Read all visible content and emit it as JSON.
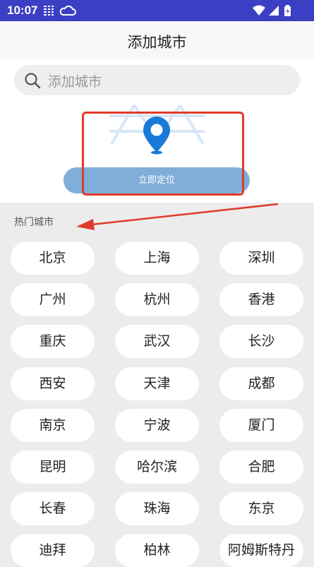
{
  "status_bar": {
    "time": "10:07"
  },
  "header": {
    "title": "添加城市"
  },
  "search": {
    "placeholder": "添加城市"
  },
  "locate": {
    "button_label": "立即定位"
  },
  "hot_cities": {
    "label": "热门城市",
    "cities": [
      "北京",
      "上海",
      "深圳",
      "广州",
      "杭州",
      "香港",
      "重庆",
      "武汉",
      "长沙",
      "西安",
      "天津",
      "成都",
      "南京",
      "宁波",
      "厦门",
      "昆明",
      "哈尔滨",
      "合肥",
      "长春",
      "珠海",
      "东京",
      "迪拜",
      "柏林",
      "阿姆斯特丹"
    ]
  },
  "colors": {
    "status_bar": "#3b3fc4",
    "locate_button": "#7eaed9",
    "pin": "#1a7ad8",
    "annotation": "#e03a2a"
  },
  "icons": [
    "grid-icon",
    "cloud-icon",
    "wifi-icon",
    "signal-icon",
    "battery-icon",
    "search-icon",
    "location-pin-icon"
  ]
}
